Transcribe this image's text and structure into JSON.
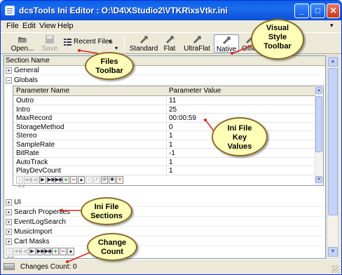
{
  "window": {
    "title": "dcsTools Ini Editor : O:\\D4\\XStudio2\\VTKR\\xsVtkr.ini",
    "min_glyph": "_",
    "max_glyph": "□",
    "close_glyph": "✕"
  },
  "menu": {
    "items": [
      "File",
      "Edit",
      "View",
      "Help"
    ],
    "dropdown_glyph": "▾"
  },
  "toolbar": {
    "open_label": "Open...",
    "save_label": "Save",
    "recent_label": "Recent Files",
    "recent_glyph": "▾",
    "more_glyph": "▾",
    "standard_label": "Standard",
    "flat_label": "Flat",
    "ultraflat_label": "UltraFlat",
    "native_label": "Native",
    "office_label": "Office"
  },
  "sections_header": "Section Name",
  "sections_top": [
    {
      "name": "General",
      "expanded": false,
      "glyph": "+"
    },
    {
      "name": "Globals",
      "expanded": true,
      "glyph": "−"
    }
  ],
  "grid": {
    "col_name": "Parameter Name",
    "col_value": "Parameter Value",
    "rows": [
      {
        "name": "Outro",
        "value": "11"
      },
      {
        "name": "Intro",
        "value": "25"
      },
      {
        "name": "MaxRecord",
        "value": "00:00:59"
      },
      {
        "name": "StorageMethod",
        "value": "0"
      },
      {
        "name": "Stereo",
        "value": "1"
      },
      {
        "name": "SampleRate",
        "value": "1"
      },
      {
        "name": "BitRate",
        "value": "-1"
      },
      {
        "name": "AutoTrack",
        "value": "1"
      },
      {
        "name": "PlayDevCount",
        "value": "1"
      }
    ]
  },
  "sections_bottom": [
    {
      "name": "UI",
      "glyph": "+"
    },
    {
      "name": "Search Properties",
      "glyph": "+"
    },
    {
      "name": "EventLogSearch",
      "glyph": "+"
    },
    {
      "name": "MusicImport",
      "glyph": "+"
    },
    {
      "name": "Cart Masks",
      "glyph": "+"
    }
  ],
  "nav_glyphs": {
    "first": "|◀◀",
    "prev_page": "◀◀",
    "prev": "◀",
    "next": "▶",
    "next_page": "▶▶",
    "last": "▶▶|",
    "add": "+",
    "delete": "−",
    "up": "▲",
    "post": "✓",
    "cancel": "✗",
    "refresh": "⟳",
    "star": "✱",
    "filter": "▼"
  },
  "scroll_glyphs": {
    "up": "▲",
    "down": "▼"
  },
  "status": {
    "text": "Changes Count: 0"
  },
  "callouts": [
    {
      "lines": [
        "Visual",
        "Style",
        "Toolbar"
      ]
    },
    {
      "lines": [
        "Files",
        "Toolbar"
      ]
    },
    {
      "lines": [
        "Ini File",
        "Key",
        "Values"
      ]
    },
    {
      "lines": [
        "Ini File",
        "Sections"
      ]
    },
    {
      "lines": [
        "Change",
        "Count"
      ]
    }
  ],
  "colors": {
    "titlebar": "#0a5fe8",
    "callout_fill": "#ffffb8",
    "callout_border": "#8a6a2a",
    "add_green": "#1a9a1a",
    "delete_red": "#d22222",
    "filter_orange": "#e08a10",
    "panel_border": "#7f9db9"
  },
  "icons": [
    "app-icon",
    "open-folder-icon",
    "save-disk-icon",
    "recent-files-icon",
    "standard-style-icon",
    "flat-style-icon",
    "ultraflat-style-icon",
    "native-style-icon",
    "office-style-icon",
    "status-icon",
    "resize-grip-icon"
  ]
}
